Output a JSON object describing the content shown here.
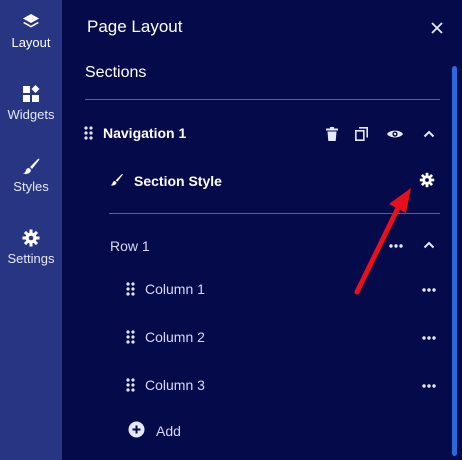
{
  "rail": {
    "items": [
      {
        "label": "Layout",
        "icon": "layers-icon",
        "active": true
      },
      {
        "label": "Widgets",
        "icon": "widgets-icon",
        "active": false
      },
      {
        "label": "Styles",
        "icon": "brush-icon",
        "active": false
      },
      {
        "label": "Settings",
        "icon": "gear-icon",
        "active": false
      }
    ]
  },
  "panel": {
    "title": "Page Layout",
    "close_icon": "close-icon",
    "sections_heading": "Sections",
    "section": {
      "name": "Navigation 1",
      "actions": [
        "trash-icon",
        "copy-icon",
        "eye-icon",
        "chevron-up-icon"
      ],
      "style_label": "Section Style",
      "style_icon": "brush-icon",
      "settings_icon": "gear-icon",
      "row": {
        "name": "Row 1",
        "columns": [
          {
            "label": "Column 1"
          },
          {
            "label": "Column 2"
          },
          {
            "label": "Column 3"
          }
        ],
        "add_label": "Add"
      }
    }
  },
  "colors": {
    "rail_bg": "#283582",
    "panel_bg": "#050a4a",
    "scroll_thumb": "#2c69d8",
    "annotation_arrow": "#e8101c"
  }
}
